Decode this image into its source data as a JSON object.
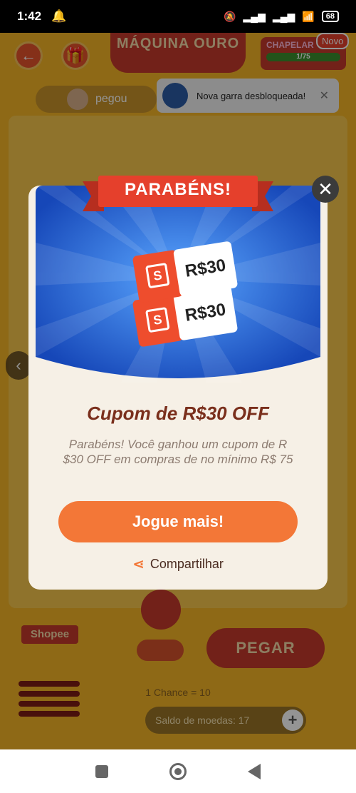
{
  "status_bar": {
    "time": "1:42",
    "battery": "68"
  },
  "game": {
    "machine_title": "MÁQUINA OURO",
    "chapel_label": "CHAPELAR",
    "chapel_progress_text": "1/75",
    "novo_badge": "Novo",
    "user_label": "pegou",
    "shopee_label": "Shopee",
    "grab_button": "PEGAR",
    "chance_text": "1 Chance = 10",
    "balance_text": "Saldo de moedas: 17"
  },
  "toast": {
    "text": "Nova garra desbloqueada!"
  },
  "modal": {
    "ribbon": "PARABÉNS!",
    "coupon_value": "R$30",
    "title": "Cupom de R$30 OFF",
    "description": "Parabéns! Você ganhou um cupom de R $30 OFF em compras de no mínimo R$ 75",
    "play_button": "Jogue mais!",
    "share_label": "Compartilhar"
  },
  "colors": {
    "accent_orange": "#f37737",
    "hero_blue": "#1b56c4",
    "ribbon_red": "#e5402c",
    "title_brown": "#7a2f1c"
  }
}
